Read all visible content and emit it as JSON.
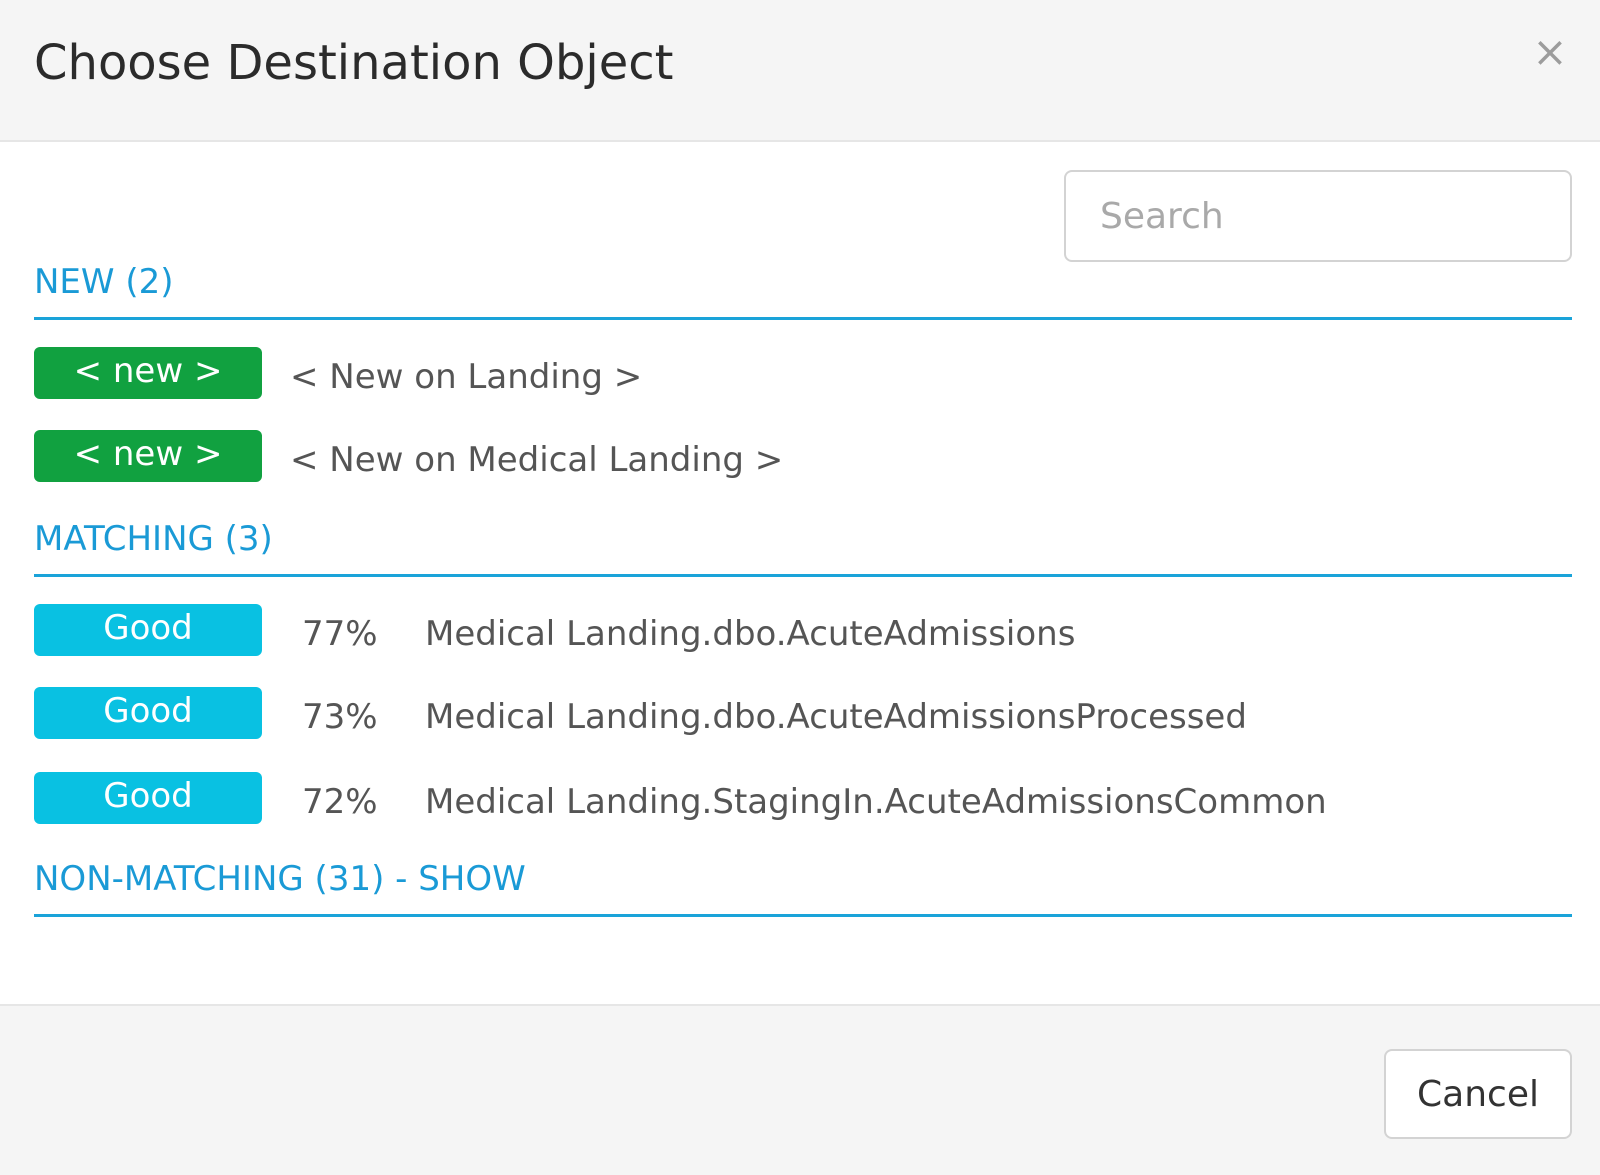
{
  "dialog": {
    "title": "Choose Destination Object",
    "close_glyph": "×",
    "close_icon": "close-icon"
  },
  "search": {
    "placeholder": "Search",
    "value": ""
  },
  "sections": {
    "new": {
      "header": "NEW (2)",
      "items": [
        {
          "badge": "< new >",
          "badge_color": "#11a140",
          "label": "< New on Landing >"
        },
        {
          "badge": "< new >",
          "badge_color": "#11a140",
          "label": "< New on Medical Landing >"
        }
      ]
    },
    "matching": {
      "header": "MATCHING (3)",
      "items": [
        {
          "badge": "Good",
          "badge_color": "#09c1e2",
          "percent": "77%",
          "label": "Medical Landing.dbo.AcuteAdmissions"
        },
        {
          "badge": "Good",
          "badge_color": "#09c1e2",
          "percent": "73%",
          "label": "Medical Landing.dbo.AcuteAdmissionsProcessed"
        },
        {
          "badge": "Good",
          "badge_color": "#09c1e2",
          "percent": "72%",
          "label": "Medical Landing.StagingIn.AcuteAdmissionsCommon"
        }
      ]
    },
    "non_matching": {
      "header": "NON-MATCHING (31) - SHOW"
    }
  },
  "footer": {
    "cancel_label": "Cancel"
  },
  "colors": {
    "accent": "#1a9ad6",
    "new_badge": "#11a140",
    "good_badge": "#09c1e2"
  }
}
